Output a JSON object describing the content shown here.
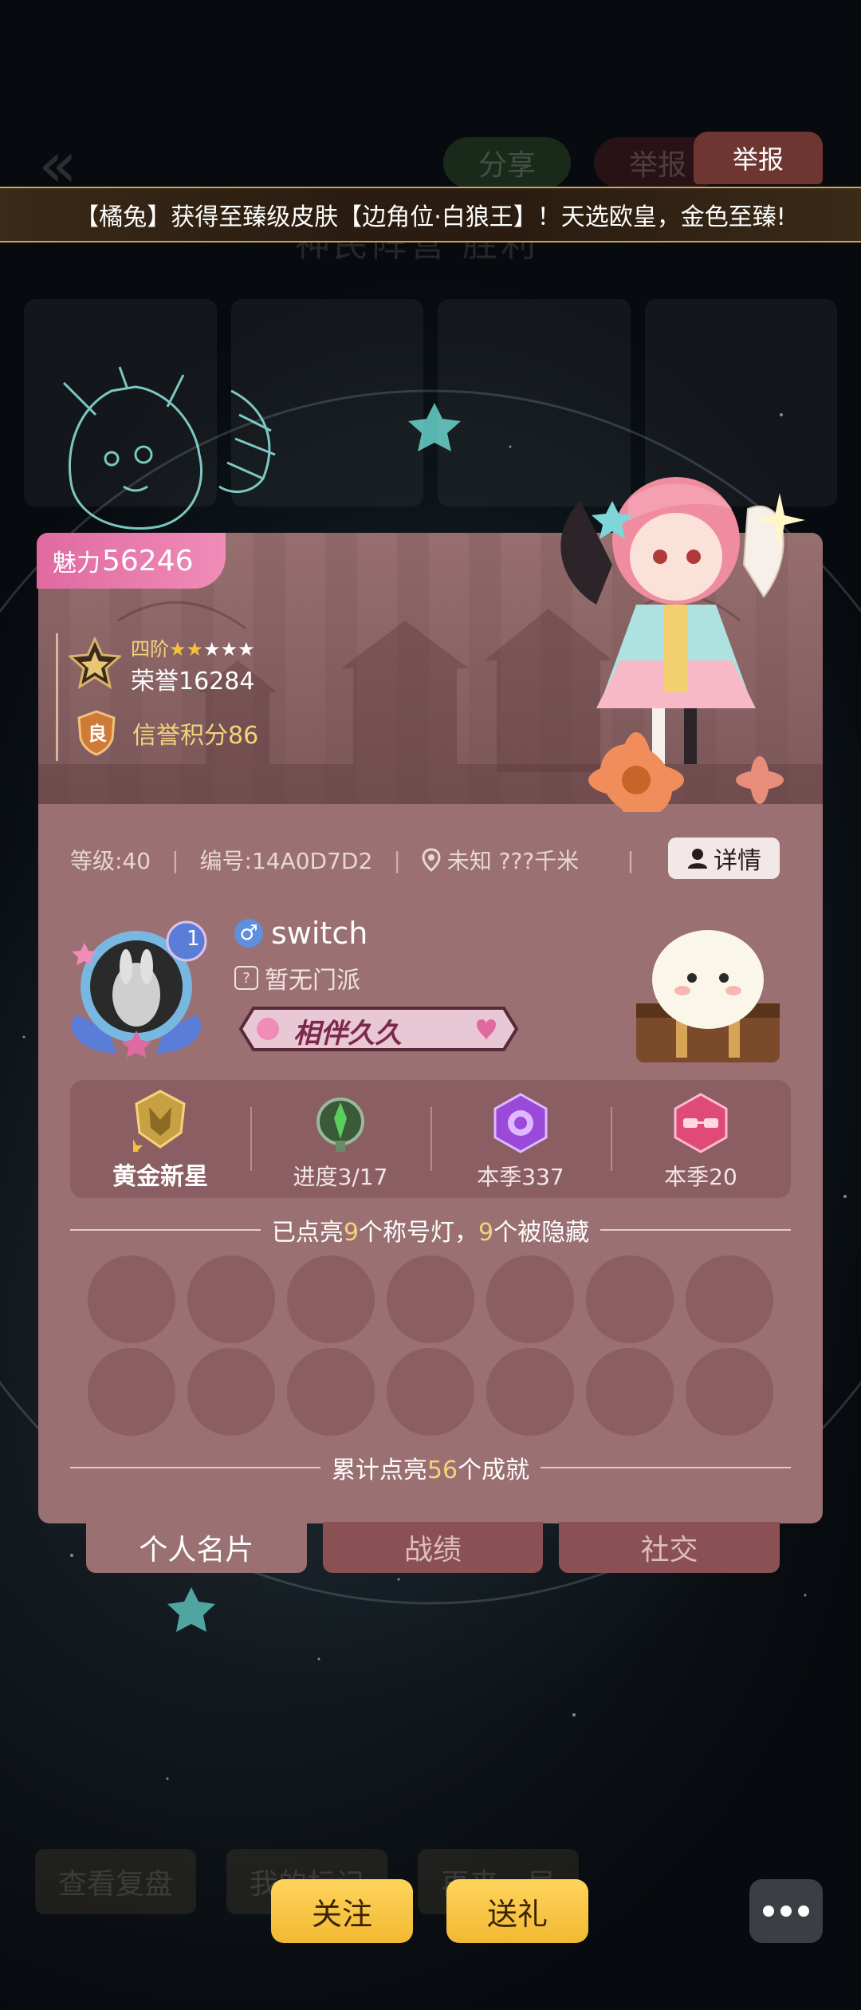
{
  "background": {
    "title": "神民阵营 胜利",
    "share_label": "分享",
    "report_label_bg": "举报",
    "bottom_buttons": [
      "查看复盘",
      "我的标记",
      "再来一局"
    ]
  },
  "report_button": "举报",
  "banner": {
    "text": "【橘兔】获得至臻级皮肤【边角位·白狼王】！天选欧皇，金色至臻!"
  },
  "profile": {
    "charm_label": "魅力",
    "charm_value": "56246",
    "rank_tier": "四阶",
    "rank_stars_filled": 2,
    "rank_stars_total": 5,
    "honor": "荣誉16284",
    "credit_badge": "良",
    "credit": "信誉积分86",
    "level": "等级:40",
    "id": "编号:14A0D7D2",
    "location": "未知 ???千米",
    "detail_label": "详情",
    "avatar_level": "1",
    "name": "switch",
    "gender_symbol": "♂",
    "sect": "暂无门派",
    "partner_badge": "相伴久久",
    "stats": [
      {
        "label": "黄金新星",
        "icon": "wolf-crest-icon"
      },
      {
        "label": "进度3/17",
        "icon": "green-emblem-icon"
      },
      {
        "label": "本季337",
        "icon": "purple-rose-icon"
      },
      {
        "label": "本季20",
        "icon": "pink-glasses-icon"
      }
    ],
    "titles_text": {
      "a": "已点亮",
      "b": "9",
      "c": "个称号灯，",
      "d": "9",
      "e": "个被隐藏"
    },
    "achievements_text": {
      "a": "累计点亮",
      "b": "56",
      "c": "个成就"
    }
  },
  "tabs": [
    {
      "label": "个人名片",
      "active": true
    },
    {
      "label": "战绩",
      "active": false
    },
    {
      "label": "社交",
      "active": false
    }
  ],
  "actions": {
    "follow": "关注",
    "gift": "送礼"
  },
  "colors": {
    "card": "#9a7073",
    "accent_gold": "#f4d37a",
    "charm_pink": "#e06aa0",
    "button_gold": "#ffd45c"
  }
}
